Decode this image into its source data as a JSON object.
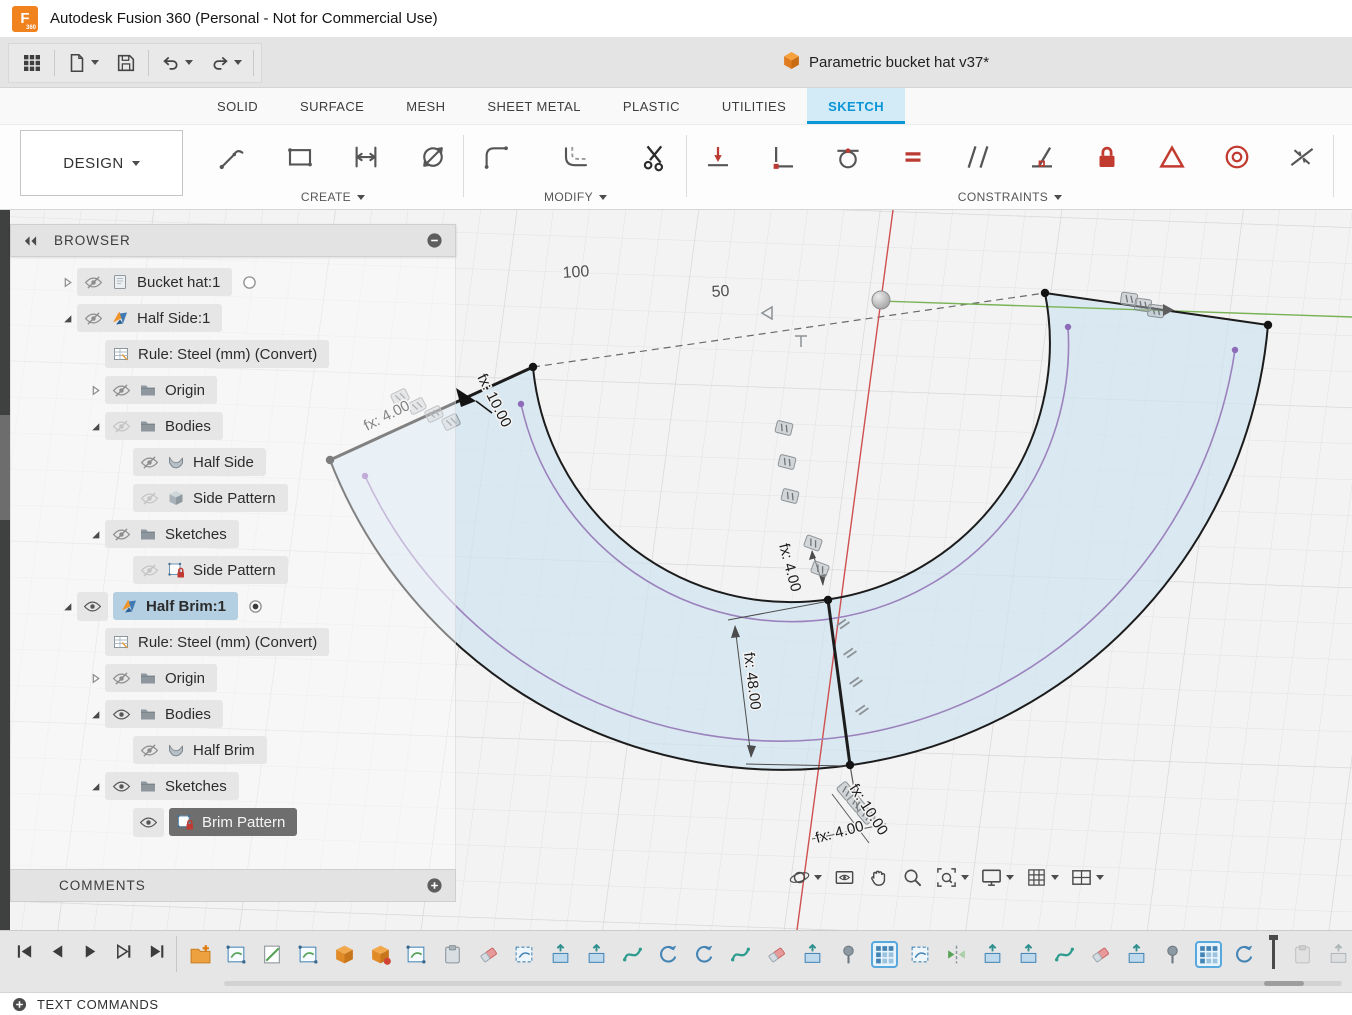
{
  "titlebar": {
    "logo_text": "F",
    "logo_sub": "360",
    "app_title": "Autodesk Fusion 360 (Personal - Not for Commercial Use)"
  },
  "qat": {
    "document": {
      "title": "Parametric bucket hat v37*"
    }
  },
  "tabs": [
    {
      "label": "SOLID",
      "active": false
    },
    {
      "label": "SURFACE",
      "active": false
    },
    {
      "label": "MESH",
      "active": false
    },
    {
      "label": "SHEET METAL",
      "active": false
    },
    {
      "label": "PLASTIC",
      "active": false
    },
    {
      "label": "UTILITIES",
      "active": false
    },
    {
      "label": "SKETCH",
      "active": true
    }
  ],
  "ribbon": {
    "design_label": "DESIGN",
    "groups": [
      {
        "label": "CREATE",
        "tools": [
          "line",
          "rectangle",
          "dimension",
          "sketch-dimension"
        ]
      },
      {
        "label": "MODIFY",
        "tools": [
          "fillet",
          "offset",
          "trim"
        ]
      },
      {
        "label": "CONSTRAINTS",
        "tools": [
          "coincident",
          "horizontal-vertical",
          "tangent",
          "equal",
          "parallel",
          "perpendicular",
          "fix",
          "midpoint",
          "concentric",
          "symmetry"
        ]
      }
    ]
  },
  "browser": {
    "title": "BROWSER",
    "comments": "COMMENTS",
    "rows": [
      {
        "label": "Bucket hat:1",
        "level": 0,
        "expand": "collapsed",
        "eye": "hidden",
        "icon": "component-doc",
        "radio": "unselected"
      },
      {
        "label": "Half Side:1",
        "level": 0,
        "expand": "expanded",
        "eye": "hidden",
        "icon": "component"
      },
      {
        "label": "Rule: Steel (mm) (Convert)",
        "level": 1,
        "icon": "rule"
      },
      {
        "label": "Origin",
        "level": 1,
        "expand": "collapsed",
        "eye": "hidden",
        "icon": "folder"
      },
      {
        "label": "Bodies",
        "level": 1,
        "expand": "expanded",
        "eye": "dim",
        "icon": "folder"
      },
      {
        "label": "Half Side",
        "level": 2,
        "eye": "hidden",
        "icon": "body-surface"
      },
      {
        "label": "Side Pattern",
        "level": 2,
        "eye": "dim",
        "icon": "body-solid"
      },
      {
        "label": "Sketches",
        "level": 1,
        "expand": "expanded",
        "eye": "hidden",
        "icon": "folder"
      },
      {
        "label": "Side Pattern",
        "level": 2,
        "eye": "dim",
        "icon": "sketch"
      },
      {
        "label": "Half Brim:1",
        "level": 0,
        "expand": "expanded",
        "eye": "visible",
        "icon": "component",
        "selected": "active",
        "radio": "selected"
      },
      {
        "label": "Rule: Steel (mm) (Convert)",
        "level": 1,
        "icon": "rule"
      },
      {
        "label": "Origin",
        "level": 1,
        "expand": "collapsed",
        "eye": "hidden",
        "icon": "folder"
      },
      {
        "label": "Bodies",
        "level": 1,
        "expand": "expanded",
        "eye": "visible",
        "icon": "folder"
      },
      {
        "label": "Half Brim",
        "level": 2,
        "eye": "hidden",
        "icon": "body-surface"
      },
      {
        "label": "Sketches",
        "level": 1,
        "expand": "expanded",
        "eye": "visible",
        "icon": "folder"
      },
      {
        "label": "Brim Pattern",
        "level": 2,
        "eye": "visible",
        "icon": "sketch",
        "selected": "dark"
      }
    ]
  },
  "canvas": {
    "grid_labels": [
      "100",
      "50"
    ],
    "dimensions": {
      "cap_width": "fx: 4.00",
      "cap_length": "fx: 10.00",
      "seam_gap": "fx: 4.00",
      "seam_length": "fx: 48.00",
      "bottom_length": "fx: 10.00",
      "bottom_width": "fx: 4.00"
    }
  },
  "nav_toolbar": [
    {
      "name": "orbit",
      "caret": true
    },
    {
      "name": "look-at",
      "caret": false
    },
    {
      "name": "pan",
      "caret": false
    },
    {
      "name": "zoom",
      "caret": false
    },
    {
      "name": "fit",
      "caret": true
    },
    {
      "name": "display-settings",
      "caret": true
    },
    {
      "name": "grid-settings",
      "caret": true
    },
    {
      "name": "viewports",
      "caret": true
    }
  ],
  "timeline": {
    "playback": [
      "skip-start",
      "step-back",
      "play",
      "step-forward",
      "skip-end"
    ],
    "features": [
      {
        "kind": "new-component"
      },
      {
        "kind": "sketch"
      },
      {
        "kind": "construct"
      },
      {
        "kind": "sketch"
      },
      {
        "kind": "form"
      },
      {
        "kind": "form-edit"
      },
      {
        "kind": "sketch"
      },
      {
        "kind": "paste"
      },
      {
        "kind": "delete"
      },
      {
        "kind": "sketch-dashed"
      },
      {
        "kind": "extrude"
      },
      {
        "kind": "extrude"
      },
      {
        "kind": "stitch"
      },
      {
        "kind": "reverse"
      },
      {
        "kind": "reverse"
      },
      {
        "kind": "stitch"
      },
      {
        "kind": "delete"
      },
      {
        "kind": "extrude"
      },
      {
        "kind": "pin"
      },
      {
        "kind": "pattern",
        "selected": true
      },
      {
        "kind": "sketch-dashed"
      },
      {
        "kind": "mirror"
      },
      {
        "kind": "extrude"
      },
      {
        "kind": "extrude"
      },
      {
        "kind": "stitch"
      },
      {
        "kind": "delete"
      },
      {
        "kind": "extrude"
      },
      {
        "kind": "pin"
      },
      {
        "kind": "pattern",
        "selected": true
      },
      {
        "kind": "reverse"
      },
      {
        "kind": "marker"
      },
      {
        "kind": "paste",
        "state": "inactive"
      },
      {
        "kind": "extrude",
        "state": "inactive"
      }
    ]
  },
  "statusbar": {
    "label": "TEXT COMMANDS"
  }
}
